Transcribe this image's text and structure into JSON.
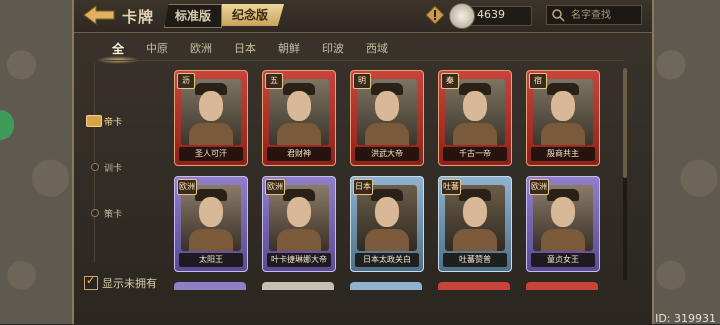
{
  "header": {
    "title": "卡牌",
    "version_tabs": [
      {
        "label": "标准版",
        "active": false
      },
      {
        "label": "纪念版",
        "active": true
      }
    ],
    "currency_value": "4639",
    "search_placeholder": "名字查找"
  },
  "region_tabs": [
    "全",
    "中原",
    "欧洲",
    "日本",
    "朝鲜",
    "印波",
    "西域"
  ],
  "active_region": "全",
  "side_nav": [
    {
      "label": "帝卡",
      "active": true
    },
    {
      "label": "训卡",
      "active": false
    },
    {
      "label": "策卡",
      "active": false
    }
  ],
  "cards_row1": [
    {
      "badge": "沥",
      "name": "圣人可汗",
      "frame": "red"
    },
    {
      "badge": "五",
      "name": "君财神",
      "frame": "red"
    },
    {
      "badge": "明",
      "name": "洪武大帝",
      "frame": "red"
    },
    {
      "badge": "秦",
      "name": "千古一帝",
      "frame": "red"
    },
    {
      "badge": "宿",
      "name": "殷商共主",
      "frame": "red"
    }
  ],
  "cards_row2": [
    {
      "badge": "欧洲",
      "name": "太阳王",
      "frame": "purple"
    },
    {
      "badge": "欧洲",
      "name": "叶卡捷琳娜大帝",
      "frame": "purple"
    },
    {
      "badge": "日本",
      "name": "日本太政关白",
      "frame": "blue"
    },
    {
      "badge": "吐蕃",
      "name": "吐蕃赞普",
      "frame": "blue"
    },
    {
      "badge": "欧洲",
      "name": "童贞女王",
      "frame": "purple"
    }
  ],
  "show_not_owned_label": "显示未拥有",
  "user_id": "ID: 319931",
  "colors": {
    "accent_gold": "#d7a44a",
    "panel_bg": "#2b2620",
    "red_frame": "#c8443a",
    "purple_frame": "#8f7fc9",
    "blue_frame": "#8fb3cf"
  },
  "icons": {
    "back": "back-arrow-icon",
    "warning": "warning-icon",
    "currency": "coin-icon",
    "search": "search-icon"
  }
}
